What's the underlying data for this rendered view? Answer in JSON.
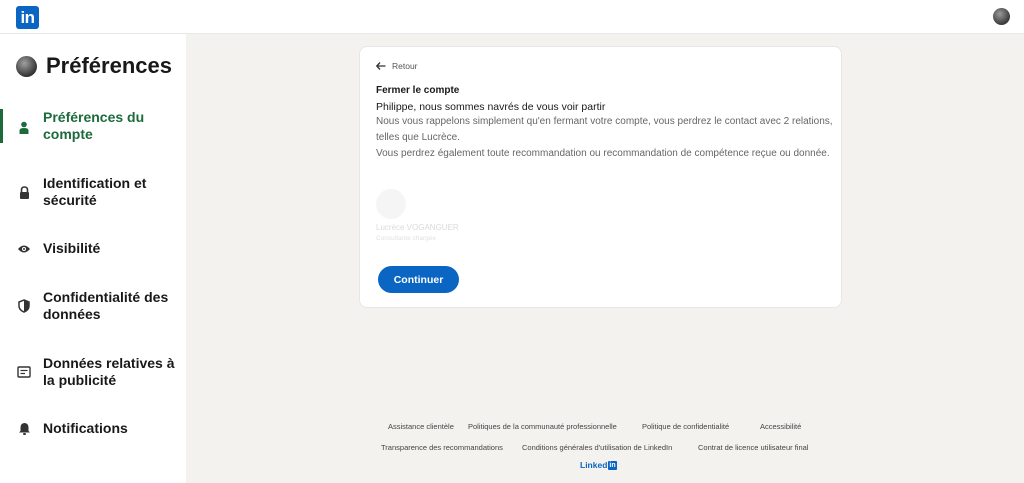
{
  "topbar": {
    "logo_text": "in"
  },
  "sidebar": {
    "title": "Préférences",
    "items": [
      {
        "label": "Préférences du compte",
        "icon": "person-icon",
        "active": true
      },
      {
        "label": "Identification et sécurité",
        "icon": "lock-icon"
      },
      {
        "label": "Visibilité",
        "icon": "eye-icon"
      },
      {
        "label": "Confidentialité des données",
        "icon": "shield-icon"
      },
      {
        "label": "Données relatives à la publicité",
        "icon": "ad-icon"
      },
      {
        "label": "Notifications",
        "icon": "bell-icon"
      }
    ]
  },
  "card": {
    "back_label": "Retour",
    "title": "Fermer le compte",
    "subtitle": "Philippe, nous sommes navrés de vous voir partir",
    "text_line1": "Nous vous rappelons simplement qu'en fermant votre compte, vous perdrez le contact avec 2 relations, telles que Lucrèce.",
    "text_line2": "Vous perdrez également toute recommandation ou recommandation de compétence reçue ou donnée.",
    "contact_name": "Lucrèce VOGANGUER",
    "contact_title": "Consultante chargée",
    "continue_label": "Continuer"
  },
  "footer": {
    "row1": [
      "Assistance clientèle",
      "Politiques de la communauté professionnelle",
      "Politique de confidentialité",
      "Accessibilité"
    ],
    "row2": [
      "Transparence des recommandations",
      "Conditions générales d'utilisation de LinkedIn",
      "Contrat de licence utilisateur final"
    ],
    "logo_word": "Linked",
    "logo_in": "in"
  },
  "colors": {
    "brand": "#0a66c2",
    "active_green": "#1d6b3c",
    "background": "#f4f2ee"
  }
}
